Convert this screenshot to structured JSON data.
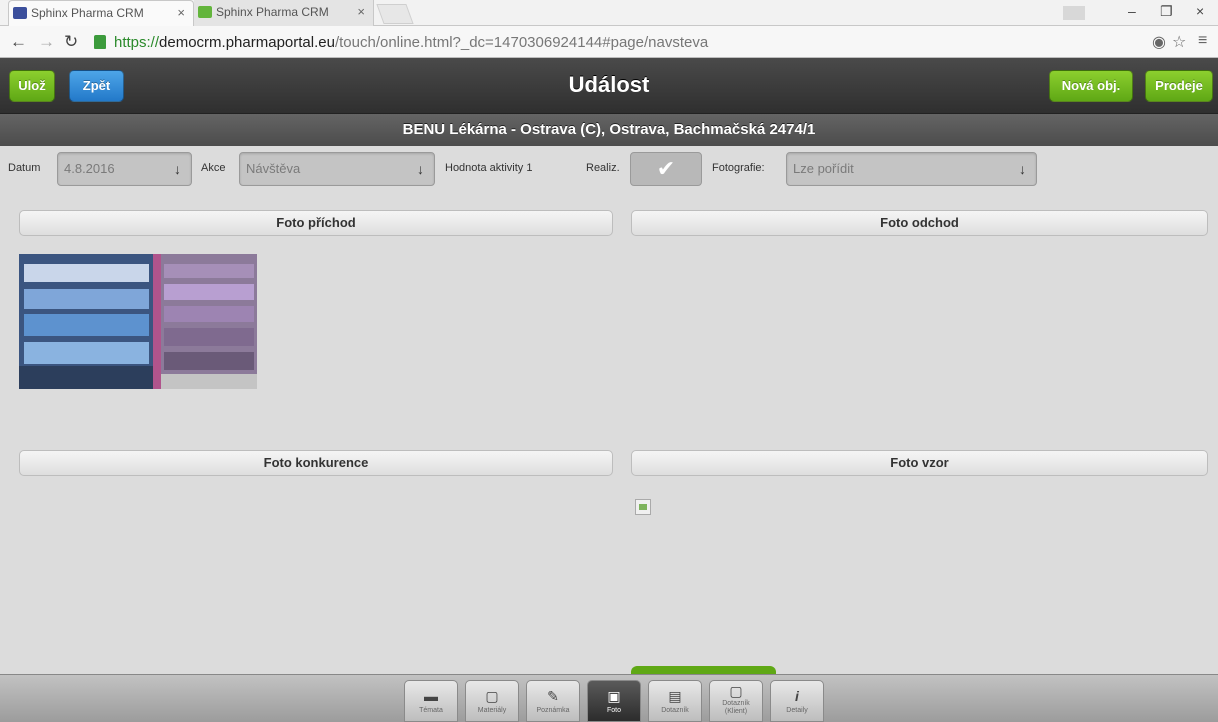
{
  "browser": {
    "tabs": [
      {
        "title": "Sphinx Pharma CRM",
        "close": "×"
      },
      {
        "title": "Sphinx Pharma CRM",
        "close": "×"
      }
    ],
    "url_scheme": "https://",
    "url_host": "democrm.pharmaportal.eu",
    "url_path": "/touch/online.html?_dc=1470306924144#page/navsteva",
    "window_controls": {
      "minimize": "–",
      "restore": "❐",
      "close": "×"
    }
  },
  "header": {
    "save_label": "Ulož",
    "back_label": "Zpět",
    "title": "Událost",
    "new_order_label": "Nová obj.",
    "sales_label": "Prodeje"
  },
  "subheader": {
    "text": "BENU Lékárna - Ostrava (C), Ostrava, Bachmačská 2474/1"
  },
  "form": {
    "date_label": "Datum",
    "date_value": "4.8.2016",
    "action_label": "Akce",
    "action_value": "Návštěva",
    "activity_value_label": "Hodnota aktivity 1",
    "realized_label": "Realiz.",
    "photos_label": "Fotografie:",
    "photos_value": "Lze pořídit"
  },
  "sections": {
    "arrival": "Foto příchod",
    "departure": "Foto odchod",
    "competition": "Foto konkurence",
    "template": "Foto vzor"
  },
  "footer": {
    "tabs": [
      {
        "label": "Témata",
        "icon": "chat-icon"
      },
      {
        "label": "Materiály",
        "icon": "box-icon"
      },
      {
        "label": "Poznámka",
        "icon": "note-icon"
      },
      {
        "label": "Foto",
        "icon": "camera-icon"
      },
      {
        "label": "Dotazník",
        "icon": "form-icon"
      },
      {
        "label": "Dotazník (Klient)",
        "icon": "square-icon"
      },
      {
        "label": "Detaily",
        "icon": "info-icon"
      }
    ]
  },
  "colors": {
    "green_button": "#6db51f",
    "blue_button": "#2d86d6",
    "header_bg": "#3a3a3a"
  }
}
